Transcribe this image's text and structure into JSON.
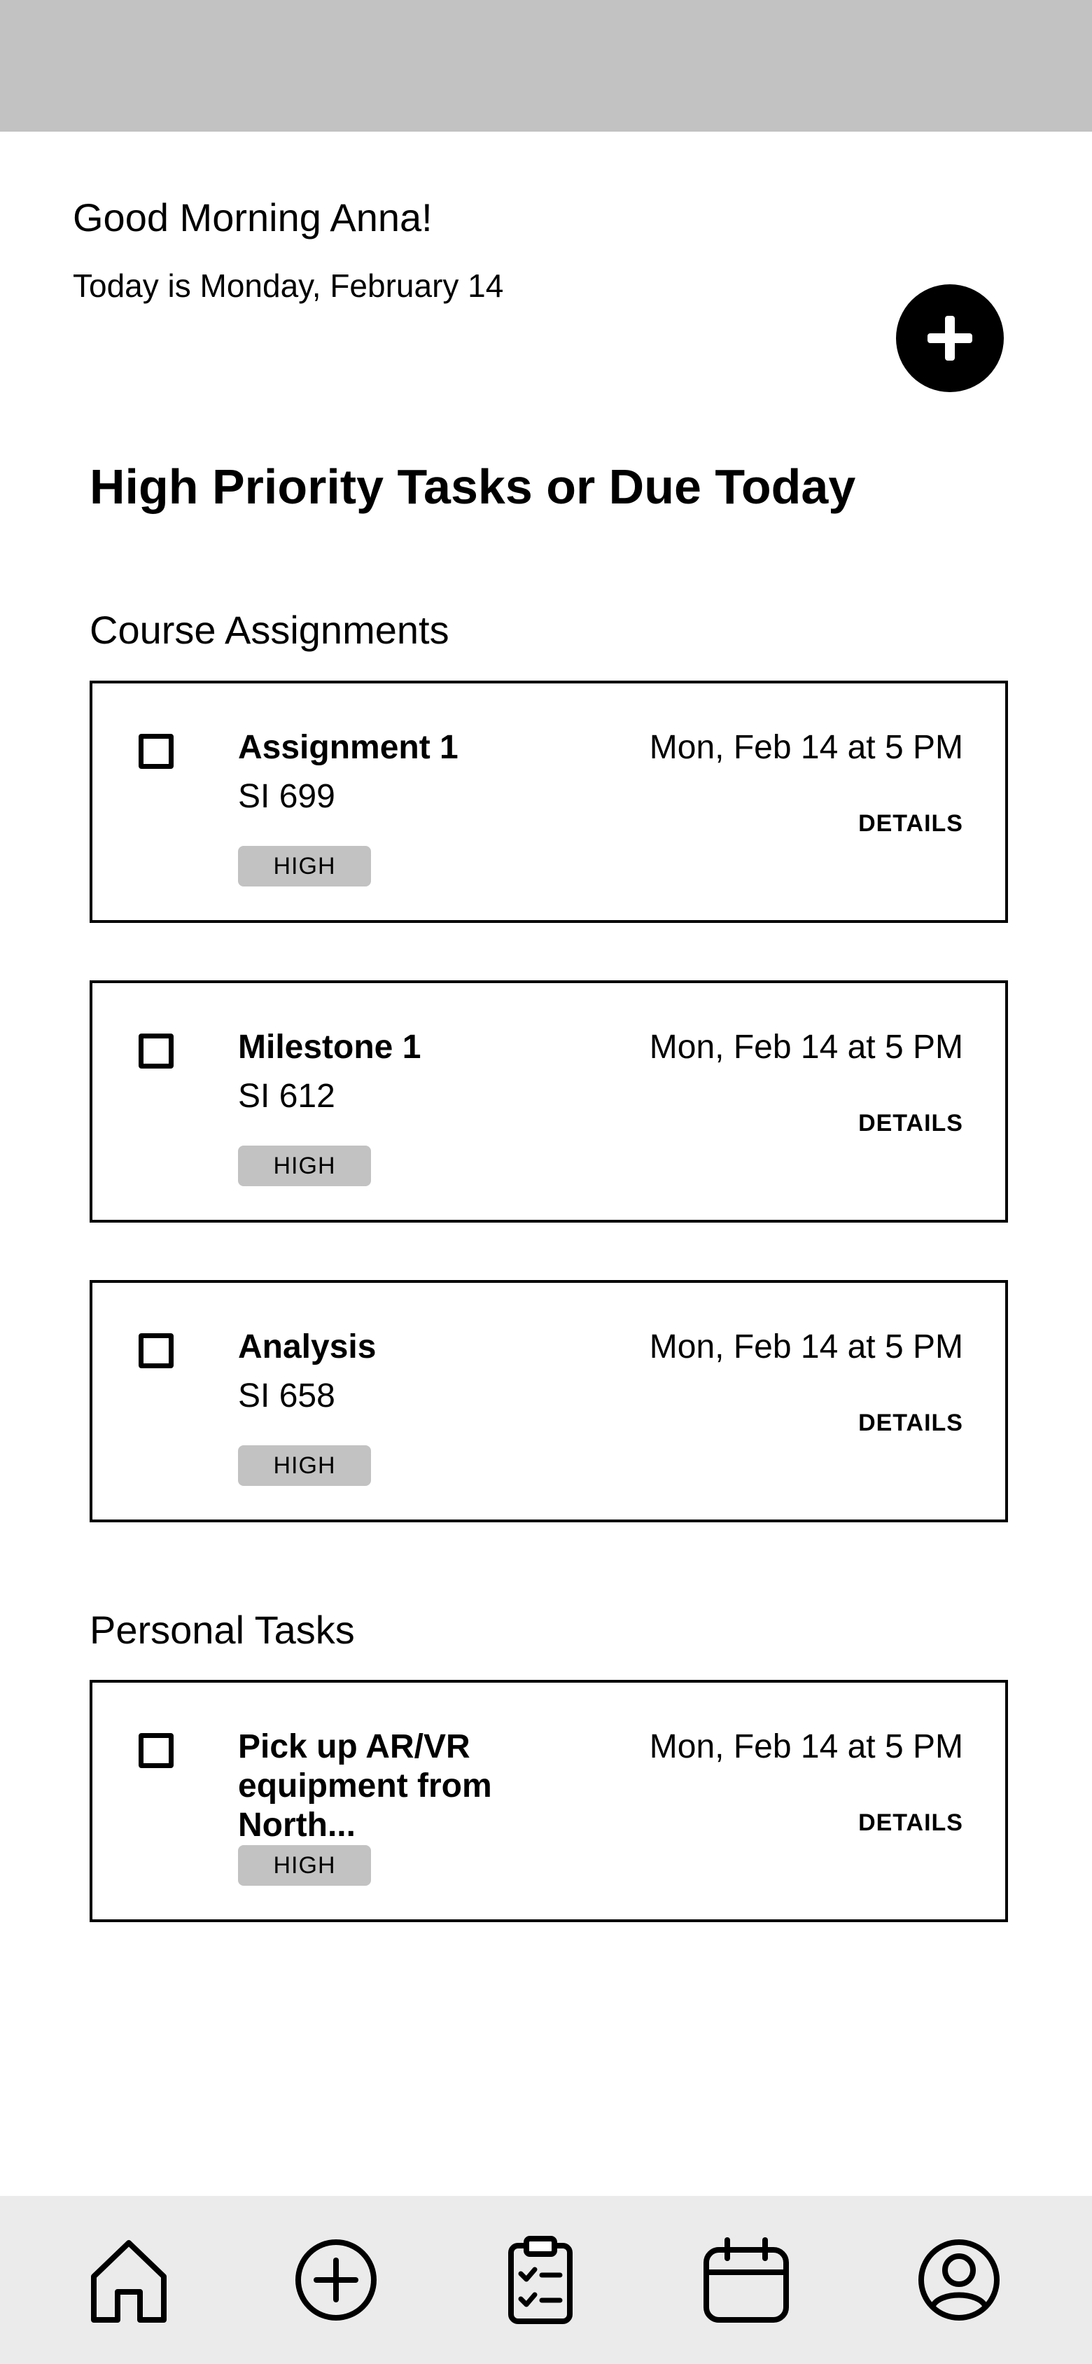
{
  "header": {
    "greeting": "Good Morning Anna!",
    "date_text": "Today is Monday, February 14",
    "add_icon": "plus-icon"
  },
  "main": {
    "section_title": "High Priority Tasks or Due Today",
    "groups": [
      {
        "label": "Course Assignments",
        "tasks": [
          {
            "title": "Assignment 1",
            "course": "SI 699",
            "due": "Mon, Feb 14 at 5 PM",
            "priority": "HIGH",
            "details_label": "DETAILS",
            "checked": false
          },
          {
            "title": "Milestone 1",
            "course": "SI 612",
            "due": "Mon, Feb 14 at 5 PM",
            "priority": "HIGH",
            "details_label": "DETAILS",
            "checked": false
          },
          {
            "title": "Analysis",
            "course": "SI 658",
            "due": "Mon, Feb 14 at 5 PM",
            "priority": "HIGH",
            "details_label": "DETAILS",
            "checked": false
          }
        ]
      },
      {
        "label": "Personal Tasks",
        "tasks": [
          {
            "title": "Pick up AR/VR equipment from North...",
            "due": "Mon, Feb 14 at 5 PM",
            "priority": "HIGH",
            "details_label": "DETAILS",
            "checked": false
          }
        ]
      }
    ]
  },
  "bottom_nav": {
    "items": [
      {
        "icon": "home-icon"
      },
      {
        "icon": "add-circle-icon"
      },
      {
        "icon": "clipboard-checklist-icon"
      },
      {
        "icon": "calendar-icon"
      },
      {
        "icon": "profile-icon"
      }
    ]
  },
  "colors": {
    "status_bar": "#c2c2c2",
    "badge_bg": "#c2c2c2",
    "nav_bg": "#ebebeb",
    "fab_bg": "#000000"
  }
}
